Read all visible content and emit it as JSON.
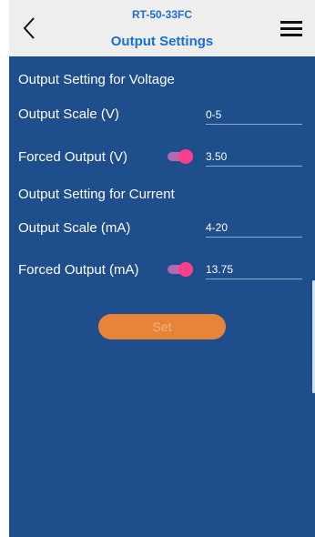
{
  "header": {
    "device_id": "RT-50-33FC",
    "title": "Output Settings",
    "back_icon": "chevron-left-icon",
    "menu_icon": "hamburger-menu-icon"
  },
  "voltage": {
    "section_title": "Output Setting for Voltage",
    "scale_label": "Output Scale (V)",
    "scale_value": "0-5",
    "forced_label": "Forced Output (V)",
    "forced_value": "3.50",
    "forced_enabled": true
  },
  "current": {
    "section_title": "Output Setting for Current",
    "scale_label": "Output Scale (mA)",
    "scale_value": "4-20",
    "forced_label": "Forced Output (mA)",
    "forced_value": "13.75",
    "forced_enabled": true
  },
  "actions": {
    "set_label": "Set"
  },
  "colors": {
    "background": "#1f4e8c",
    "header_bg": "#eeeeee",
    "header_text": "#1a6fd6",
    "toggle_on": "#ff3f8a",
    "set_button": "#e8843a"
  }
}
